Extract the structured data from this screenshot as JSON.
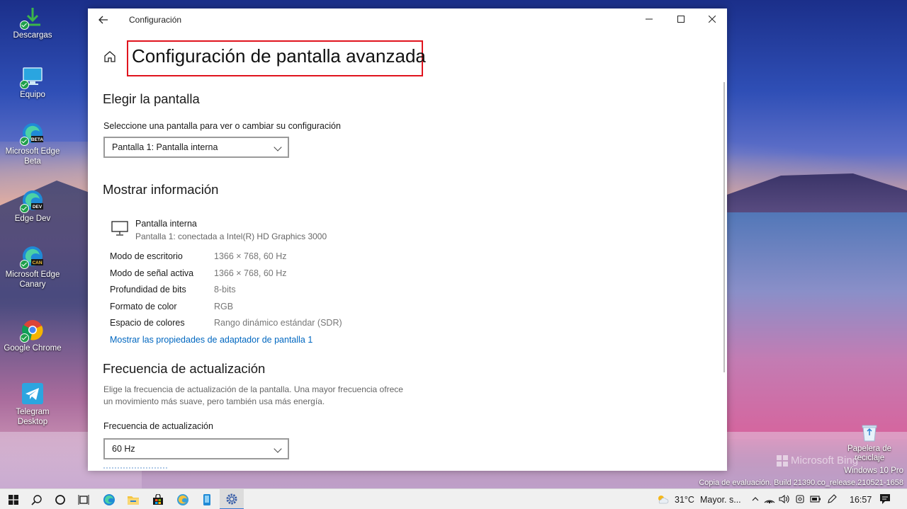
{
  "desktop": {
    "icons": [
      {
        "label": "Descargas"
      },
      {
        "label": "Equipo"
      },
      {
        "label": "Microsoft Edge Beta",
        "badge": "BETA"
      },
      {
        "label": "Edge Dev",
        "badge": "DEV"
      },
      {
        "label": "Microsoft Edge Canary",
        "badge": "CAN"
      },
      {
        "label": "Google Chrome"
      },
      {
        "label": "Telegram Desktop"
      }
    ],
    "recycle_bin": {
      "label": "Papelera de reciclaje"
    },
    "watermark": {
      "brand": "Microsoft Bing",
      "edition": "Windows 10 Pro",
      "build": "Copia de evaluación. Build 21390.co_release.210521-1658"
    }
  },
  "window": {
    "title": "Configuración",
    "page_title": "Configuración de pantalla avanzada",
    "choose_display": {
      "heading": "Elegir la pantalla",
      "label": "Seleccione una pantalla para ver o cambiar su configuración",
      "selected": "Pantalla 1: Pantalla interna"
    },
    "display_info": {
      "heading": "Mostrar información",
      "display_name": "Pantalla interna",
      "connection": "Pantalla 1: conectada a Intel(R) HD Graphics 3000",
      "rows": [
        {
          "key": "Modo de escritorio",
          "value": "1366 × 768, 60 Hz"
        },
        {
          "key": "Modo de señal activa",
          "value": "1366 × 768, 60 Hz"
        },
        {
          "key": "Profundidad de bits",
          "value": "8-bits"
        },
        {
          "key": "Formato de color",
          "value": "RGB"
        },
        {
          "key": "Espacio de colores",
          "value": "Rango dinámico estándar (SDR)"
        }
      ],
      "adapter_link": "Mostrar las propiedades de adaptador de pantalla 1"
    },
    "refresh_rate": {
      "heading": "Frecuencia de actualización",
      "description": "Elige la frecuencia de actualización de la pantalla. Una mayor frecuencia ofrece un movimiento más suave, pero también usa más energía.",
      "label": "Frecuencia de actualización",
      "selected": "60 Hz"
    }
  },
  "taskbar": {
    "weather_temp": "31°C",
    "weather_text": "Mayor. s...",
    "time": "16:57",
    "colors": {
      "accent": "#3a78d4",
      "background": "#f0f0f0"
    }
  }
}
